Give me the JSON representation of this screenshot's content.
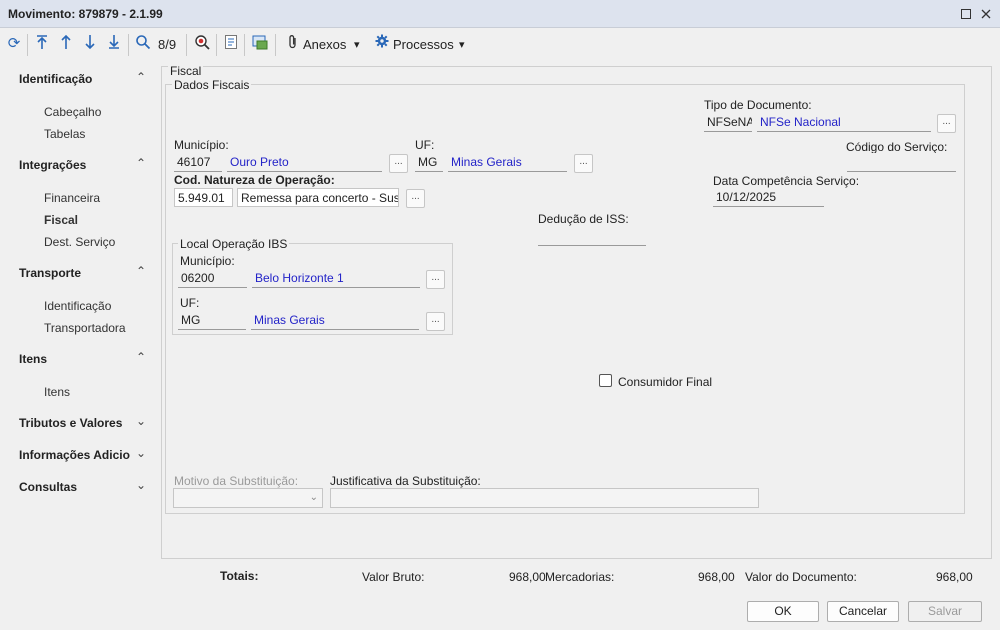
{
  "window": {
    "title": "Movimento: 879879 - 2.1.99"
  },
  "toolbar": {
    "record_counter": "8/9",
    "anexos_label": "Anexos",
    "processos_label": "Processos"
  },
  "sidebar": {
    "groups": [
      {
        "label": "Identificação",
        "items": [
          "Cabeçalho",
          "Tabelas"
        ]
      },
      {
        "label": "Integrações",
        "items": [
          "Financeira",
          "Fiscal",
          "Dest. Serviço"
        ]
      },
      {
        "label": "Transporte",
        "items": [
          "Identificação",
          "Transportadora"
        ]
      },
      {
        "label": "Itens",
        "items": [
          "Itens"
        ]
      },
      {
        "label": "Tributos e Valores",
        "items": []
      },
      {
        "label": "Informações Adicio",
        "items": []
      },
      {
        "label": "Consultas",
        "items": []
      }
    ]
  },
  "fiscal": {
    "outer_legend": "Fiscal",
    "inner_legend": "Dados Fiscais",
    "tipo_documento": {
      "label": "Tipo de Documento:",
      "code": "NFSeNAC",
      "desc": "NFSe Nacional"
    },
    "municipio": {
      "label": "Município:",
      "code": "46107",
      "desc": "Ouro Preto"
    },
    "uf": {
      "label": "UF:",
      "code": "MG",
      "desc": "Minas Gerais"
    },
    "codigo_servico": {
      "label": "Código do Serviço:",
      "value": ""
    },
    "natureza": {
      "label": "Cod. Natureza de Operação:",
      "code": "5.949.01",
      "desc": "Remessa para concerto - Suspen"
    },
    "data_competencia": {
      "label": "Data Competência Serviço:",
      "value": "10/12/2025"
    },
    "deducao_iss": {
      "label": "Dedução de ISS:",
      "value": ""
    },
    "local_ibs": {
      "legend": "Local Operação IBS",
      "municipio_label": "Município:",
      "municipio_code": "06200",
      "municipio_desc": "Belo Horizonte 1",
      "uf_label": "UF:",
      "uf_code": "MG",
      "uf_desc": "Minas Gerais"
    },
    "consumidor_final": {
      "label": "Consumidor Final",
      "checked": false
    },
    "motivo_substituicao": {
      "label": "Motivo da Substituição:",
      "value": ""
    },
    "justificativa_substituicao": {
      "label": "Justificativa da Substituição:",
      "value": ""
    },
    "dots_label": "..."
  },
  "totals": {
    "label": "Totais:",
    "valor_bruto_label": "Valor Bruto:",
    "valor_bruto": "968,00",
    "mercadorias_label": "Mercadorias:",
    "mercadorias": "968,00",
    "valor_documento_label": "Valor do Documento:",
    "valor_documento": "968,00"
  },
  "buttons": {
    "ok": "OK",
    "cancelar": "Cancelar",
    "salvar": "Salvar"
  },
  "icons": {
    "refresh": "⟳",
    "first": "⤒",
    "prev": "↑",
    "next": "↓",
    "last": "⤓",
    "search": "⌕",
    "chevron_up": "⌃",
    "chevron_down": "⌄",
    "dropdown": "▾"
  },
  "colors": {
    "link_blue": "#2323c8",
    "toolbar_blue": "#2a68b8"
  }
}
